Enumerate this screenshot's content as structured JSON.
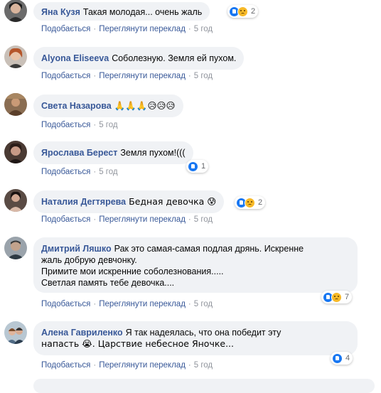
{
  "actions": {
    "like": "Подобається",
    "translate": "Переглянути переклад"
  },
  "colors": {
    "author": "#385898",
    "bubble": "#f0f2f5",
    "like_reaction": "#1877f2",
    "sad_reaction": "#f7b928"
  },
  "comments": [
    {
      "author": "Яна Кузя",
      "text": "Такая молодая... очень жаль",
      "time": "5 год",
      "reactions": [
        "like",
        "sad"
      ],
      "reaction_count": "2"
    },
    {
      "author": "Alyona Eliseeva",
      "text": "Соболезную. Земля ей пухом.",
      "time": "5 год"
    },
    {
      "author": "Света Назарова",
      "text": "🙏🙏🙏😥😥😥",
      "time": "5 год"
    },
    {
      "author": "Ярослава Берест",
      "text": "Земля пухом!(((",
      "time": "5 год",
      "reactions": [
        "like"
      ],
      "reaction_count": "1"
    },
    {
      "author": "Наталия Дегтярева",
      "text": "Бедная девочка 😰",
      "time": "5 год",
      "reactions": [
        "like",
        "sad"
      ],
      "reaction_count": "2"
    },
    {
      "author": "Дмитрий Ляшко",
      "text_lines": [
        "Рак это самая-самая подлая дрянь. Искренне",
        "жаль добрую девчонку.",
        "Примите мои искренние соболезнования.....",
        "Светлая память тебе девочка...."
      ],
      "time": "5 год",
      "reactions": [
        "like",
        "sad"
      ],
      "reaction_count": "7"
    },
    {
      "author": "Алена Гавриленко",
      "text_lines": [
        "Я так надеялась, что она победит эту",
        "напасть 😭. Царствие небесное Яночке..."
      ],
      "time": "5 год",
      "reactions": [
        "like"
      ],
      "reaction_count": "4"
    }
  ]
}
